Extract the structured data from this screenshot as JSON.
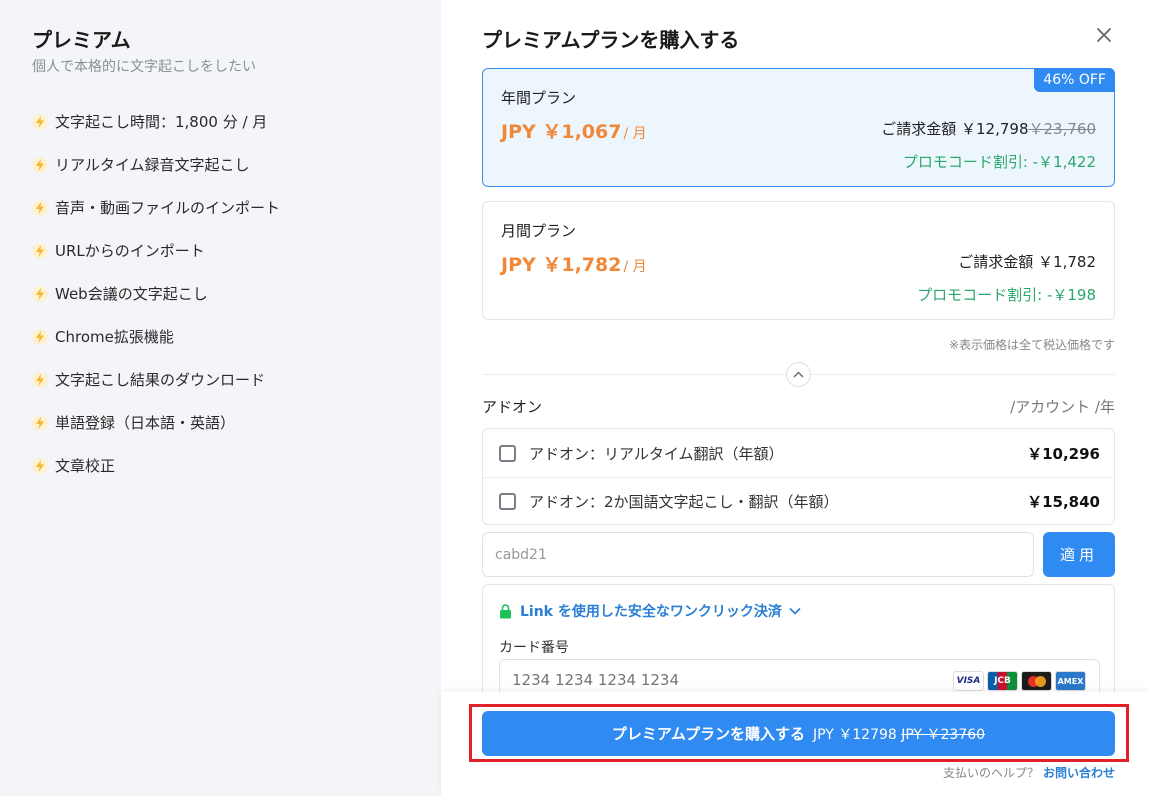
{
  "sidebar": {
    "title": "プレミアム",
    "subtitle": "個人で本格的に文字起こしをしたい",
    "features": [
      "文字起こし時間：1,800 分 / 月",
      "リアルタイム録音文字起こし",
      "音声・動画ファイルのインポート",
      "URLからのインポート",
      "Web会議の文字起こし",
      "Chrome拡張機能",
      "文字起こし結果のダウンロード",
      "単語登録（日本語・英語）",
      "文章校正"
    ],
    "accent_color": "#f5b82e"
  },
  "header": {
    "title": "プレミアムプランを購入する"
  },
  "plans": {
    "annual": {
      "name": "年間プラン",
      "badge": "46% OFF",
      "price": "JPY ￥1,067",
      "per": "/ 月",
      "billing_label": "ご請求金額 ￥12,798",
      "billing_original": "￥23,760",
      "promo": "プロモコード割引: -￥1,422"
    },
    "monthly": {
      "name": "月間プラン",
      "price": "JPY ￥1,782",
      "per": "/ 月",
      "billing_label": "ご請求金額 ￥1,782",
      "promo": "プロモコード割引: -￥198"
    },
    "tax_note": "※表示価格は全て税込価格です"
  },
  "addons": {
    "label": "アドオン",
    "unit": "/アカウント /年",
    "items": [
      {
        "label": "アドオン：リアルタイム翻訳（年額）",
        "price": "￥10,296"
      },
      {
        "label": "アドオン：2か国語文字起こし・翻訳（年額）",
        "price": "￥15,840"
      }
    ]
  },
  "promo_code": {
    "value": "cabd21",
    "apply_label": "適用"
  },
  "payment": {
    "link_text": "Link を使用した安全なワンクリック決済",
    "card_label": "カード番号",
    "card_placeholder": "1234 1234 1234 1234",
    "card_brands": [
      "VISA",
      "JCB",
      "Mastercard",
      "AMEX"
    ]
  },
  "footer": {
    "buy_label": "プレミアムプランを購入する",
    "buy_amount": "JPY ￥12798",
    "buy_original": "JPY ￥23760",
    "help_text": "支払いのヘルプ？",
    "help_link": "お問い合わせ"
  },
  "colors": {
    "primary": "#2f8af1",
    "price_orange": "#f0883a",
    "promo_green": "#2aa86c",
    "highlight_red": "#e0202a"
  }
}
